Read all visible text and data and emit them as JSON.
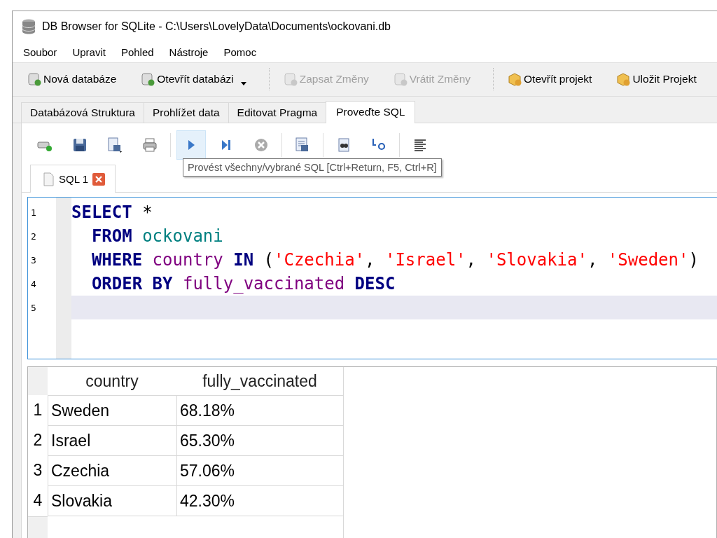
{
  "window": {
    "title": "DB Browser for SQLite - C:\\Users\\LovelyData\\Documents\\ockovani.db"
  },
  "menu": [
    {
      "label": "Soubor"
    },
    {
      "label": "Upravit"
    },
    {
      "label": "Pohled"
    },
    {
      "label": "Nástroje"
    },
    {
      "label": "Pomoc"
    }
  ],
  "toolbar": [
    {
      "label": "Nová databáze",
      "disabled": false,
      "dropdown": false,
      "separator_before": false
    },
    {
      "label": "Otevřít databázi",
      "disabled": false,
      "dropdown": true,
      "separator_before": false
    },
    {
      "label": "Zapsat Změny",
      "disabled": true,
      "dropdown": false,
      "separator_before": true
    },
    {
      "label": "Vrátit Změny",
      "disabled": true,
      "dropdown": false,
      "separator_before": false
    },
    {
      "label": "Otevřít projekt",
      "disabled": false,
      "dropdown": false,
      "separator_before": true
    },
    {
      "label": "Uložit Projekt",
      "disabled": false,
      "dropdown": false,
      "separator_before": false
    }
  ],
  "tabs": [
    {
      "label": "Databázová Struktura",
      "selected": false
    },
    {
      "label": "Prohlížet data",
      "selected": false
    },
    {
      "label": "Editovat Pragma",
      "selected": false
    },
    {
      "label": "Proveďte SQL",
      "selected": true
    }
  ],
  "sql_toolbar": [
    {
      "hovered": false
    },
    {
      "hovered": false
    },
    {
      "hovered": false
    },
    {
      "hovered": false
    },
    {
      "hovered": true
    },
    {
      "hovered": false
    },
    {
      "hovered": false
    },
    {
      "hovered": false
    },
    {
      "hovered": false
    },
    {
      "hovered": false
    },
    {
      "hovered": false
    }
  ],
  "tooltip": "Provést všechny/vybrané SQL [Ctrl+Return, F5, Ctrl+R]",
  "editor_tab": {
    "label": "SQL 1"
  },
  "editor": {
    "lines": [
      {
        "number": "1",
        "current": false,
        "tokens": [
          {
            "kind": "keyword",
            "text": "SELECT"
          },
          {
            "kind": "plain",
            "text": " *"
          }
        ]
      },
      {
        "number": "2",
        "current": false,
        "tokens": [
          {
            "kind": "keyword",
            "text": "  FROM "
          },
          {
            "kind": "table",
            "text": "ockovani"
          }
        ]
      },
      {
        "number": "3",
        "current": false,
        "tokens": [
          {
            "kind": "keyword",
            "text": "  WHERE "
          },
          {
            "kind": "column",
            "text": "country "
          },
          {
            "kind": "keyword",
            "text": "IN"
          },
          {
            "kind": "plain",
            "text": " ("
          },
          {
            "kind": "string",
            "text": "'Czechia'"
          },
          {
            "kind": "plain",
            "text": ", "
          },
          {
            "kind": "string",
            "text": "'Israel'"
          },
          {
            "kind": "plain",
            "text": ", "
          },
          {
            "kind": "string",
            "text": "'Slovakia'"
          },
          {
            "kind": "plain",
            "text": ", "
          },
          {
            "kind": "string",
            "text": "'Sweden'"
          },
          {
            "kind": "plain",
            "text": ")"
          }
        ]
      },
      {
        "number": "4",
        "current": false,
        "tokens": [
          {
            "kind": "keyword",
            "text": "  ORDER BY "
          },
          {
            "kind": "column",
            "text": "fully_vaccinated "
          },
          {
            "kind": "keyword",
            "text": "DESC"
          }
        ]
      },
      {
        "number": "5",
        "current": true
      }
    ]
  },
  "results": {
    "columns": [
      "country",
      "fully_vaccinated"
    ],
    "rows": [
      {
        "number": "1",
        "cells": [
          "Sweden",
          "68.18%"
        ]
      },
      {
        "number": "2",
        "cells": [
          "Israel",
          "65.30%"
        ]
      },
      {
        "number": "3",
        "cells": [
          "Czechia",
          "57.06%"
        ]
      },
      {
        "number": "4",
        "cells": [
          "Slovakia",
          "42.30%"
        ]
      }
    ]
  }
}
